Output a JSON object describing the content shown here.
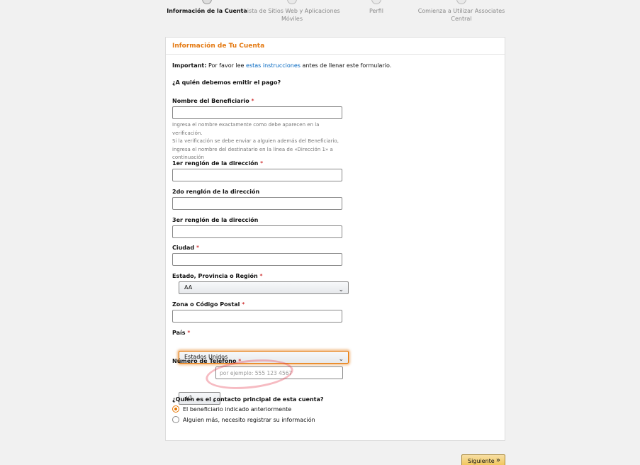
{
  "steps": [
    {
      "label": "Información de la Cuenta",
      "active": true
    },
    {
      "label": "Lista de Sitios Web y Aplicaciones Móviles",
      "active": false
    },
    {
      "label": "Perfil",
      "active": false
    },
    {
      "label": "Comienza a Utilizar Associates Central",
      "active": false
    }
  ],
  "card": {
    "title": "Información de Tu Cuenta",
    "important_bold": "Important:",
    "important_pre": "Por favor lee",
    "important_link": "estas instrucciones",
    "important_post": "antes de llenar este formulario.",
    "question_payee": "¿A quién debemos emitir el pago?"
  },
  "form": {
    "required_mark": "*",
    "beneficiary": {
      "label": "Nombre del Beneficiario",
      "value": ""
    },
    "beneficiary_hint_1": "Ingresa el nombre exactamente como debe aparecen en la verificación.",
    "beneficiary_hint_2": "Si la verificación se debe enviar a alguien además del Beneficiario,",
    "beneficiary_hint_3": "ingresa el nombre del destinatario en la línea de «Dirección 1» a",
    "beneficiary_hint_4": "continuación",
    "address1": {
      "label": "1er renglón de la dirección",
      "value": ""
    },
    "address2": {
      "label": "2do renglón de la dirección",
      "value": ""
    },
    "address3": {
      "label": "3er renglón de la dirección",
      "value": ""
    },
    "city": {
      "label": "Ciudad",
      "value": ""
    },
    "state": {
      "label": "Estado, Provincia o Región",
      "value": "AA"
    },
    "zip": {
      "label": "Zona o Código Postal",
      "value": ""
    },
    "country": {
      "label": "País",
      "value": "Estados Unidos"
    },
    "phone": {
      "label": "Número de Teléfono",
      "code": "+1",
      "placeholder": "por ejemplo: 555 123 4567",
      "value": ""
    },
    "contact_question": "¿Quién es el contacto principal de esta cuenta?",
    "contact_options": [
      {
        "label": "El beneficiario indicado anteriormente",
        "checked": true
      },
      {
        "label": "Alguien más, necesito registrar su información",
        "checked": false
      }
    ]
  },
  "next_button": "Siguiente",
  "colors": {
    "accent": "#e47911",
    "link": "#0066c0",
    "required": "#c40000",
    "button": "#f0c14b"
  }
}
